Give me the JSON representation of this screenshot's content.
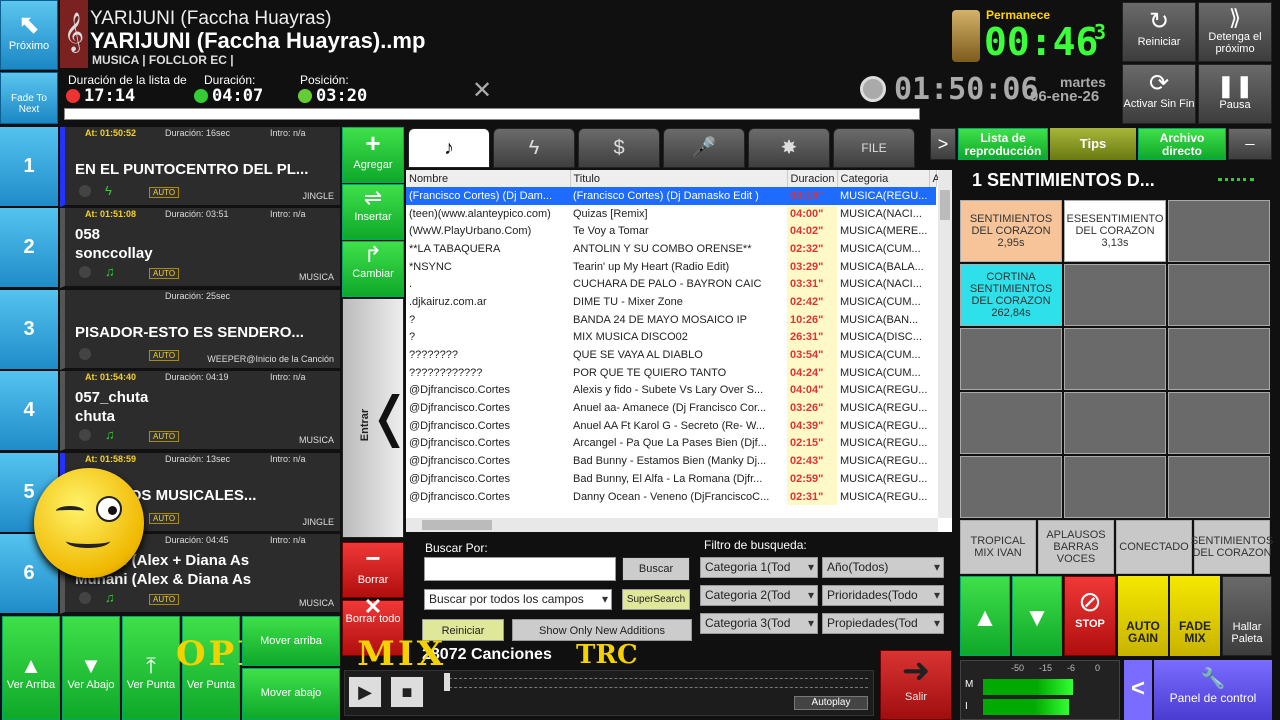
{
  "header": {
    "next_label": "Próximo",
    "fade_label": "Fade To Next",
    "title_small": "YARIJUNI (Faccha Huayras)",
    "title_big": "YARIJUNI (Faccha Huayras)..mp",
    "subtitle": "MUSICA | FOLCLOR EC |",
    "list_dur_label": "Duración de la lista de",
    "dur_label": "Duración:",
    "pos_label": "Posición:",
    "list_dur": "17:14",
    "dur": "04:07",
    "pos": "03:20",
    "clock": "01:50:06",
    "day": "martes",
    "date": "06-ene-26",
    "permanece_label": "Permanece",
    "permanece": "00:46",
    "permanece_tenths": "3"
  },
  "topbtns": {
    "reiniciar": "Reiniciar",
    "detenga": "Detenga el próximo",
    "activar": "Activar Sin Fin",
    "pausa": "Pausa"
  },
  "slots": [
    {
      "num": "1",
      "at": "At: 01:50:52",
      "dur": "Duración: 16sec",
      "intro": "Intro: n/a",
      "line1": "EN EL PUNTOCENTRO DEL PL...",
      "line2": "",
      "cat": "JINGLE",
      "auto": "AUTO"
    },
    {
      "num": "2",
      "at": "At: 01:51:08",
      "dur": "Duración: 03:51",
      "intro": "Intro: n/a",
      "line1": "058",
      "line2": "sonccollay",
      "cat": "MUSICA",
      "auto": "AUTO"
    },
    {
      "num": "3",
      "at": "",
      "dur": "Duración: 25sec",
      "intro": "",
      "line1": "PISADOR-ESTO ES SENDERO...",
      "line2": "",
      "cat": "WEEPER@Inicio de la Canción",
      "auto": "AUTO"
    },
    {
      "num": "4",
      "at": "At: 01:54:40",
      "dur": "Duración: 04:19",
      "intro": "Intro: n/a",
      "line1": "057_chuta",
      "line2": "chuta",
      "cat": "MUSICA",
      "auto": "AUTO"
    },
    {
      "num": "5",
      "at": "At: 01:58:59",
      "dur": "Duración: 13sec",
      "intro": "Intro: n/a",
      "line1": "NAEXITOS MUSICALES...",
      "line2": "",
      "cat": "JINGLE",
      "auto": "AUTO"
    },
    {
      "num": "6",
      "at": "At: 01:59:12",
      "dur": "Duración: 04:45",
      "intro": "Intro: n/a",
      "line1": "Munani (Alex + Diana As",
      "line2": "Munani (Alex & Diana As",
      "cat": "MUSICA",
      "auto": "AUTO"
    }
  ],
  "midbtns": {
    "agregar": "Agregar",
    "insertar": "Insertar",
    "cambiar": "Cambiar",
    "entrar": "Entrar",
    "borrar": "Borrar",
    "borrar_todo": "Borrar todo"
  },
  "tabs": [
    "♪",
    "ϟ",
    "$",
    "🎤",
    "✸",
    "FILE"
  ],
  "cols": [
    "Nombre",
    "Titulo",
    "Duracion",
    "Categoria",
    "A"
  ],
  "rows": [
    [
      "(Francisco Cortes) (Dj Dam...",
      "(Francisco Cortes) (Dj Damasko Edit )",
      "03:19\"",
      "MUSICA(REGU..."
    ],
    [
      "(teen)(www.alanteypico.com)",
      "Quizas [Remix]",
      "04:00\"",
      "MUSICA(NACI..."
    ],
    [
      "(WwW.PlayUrbano.Com)",
      "Te Voy a Tomar",
      "04:02\"",
      "MUSICA(MERE..."
    ],
    [
      "**LA TABAQUERA",
      "ANTOLIN Y SU COMBO ORENSE**",
      "02:32\"",
      "MUSICA(CUM..."
    ],
    [
      "*NSYNC",
      "Tearin' up My Heart (Radio Edit)",
      "03:29\"",
      "MUSICA(BALA..."
    ],
    [
      ".",
      "CUCHARA DE PALO - BAYRON CAIC",
      "03:31\"",
      "MUSICA(NACI..."
    ],
    [
      ".djkairuz.com.ar",
      "DIME TU - Mixer Zone",
      "02:42\"",
      "MUSICA(CUM..."
    ],
    [
      "?",
      "BANDA 24 DE MAYO MOSAICO IP",
      "10:26\"",
      "MUSICA(BAN..."
    ],
    [
      "?",
      "MIX MUSICA DISCO02",
      "26:31\"",
      "MUSICA(DISC..."
    ],
    [
      "????????",
      "QUE SE VAYA AL DIABLO",
      "03:54\"",
      "MUSICA(CUM..."
    ],
    [
      "????????????",
      "POR QUE TE QUIERO TANTO",
      "04:24\"",
      "MUSICA(CUM..."
    ],
    [
      "@Djfrancisco.Cortes",
      "Alexis y fido - Subete Vs Lary Over S...",
      "04:04\"",
      "MUSICA(REGU..."
    ],
    [
      "@Djfrancisco.Cortes",
      "Anuel aa- Amanece (Dj Francisco Cor...",
      "03:26\"",
      "MUSICA(REGU..."
    ],
    [
      "@Djfrancisco.Cortes",
      "Anuel AA Ft Karol G - Secreto (Re- W...",
      "04:39\"",
      "MUSICA(REGU..."
    ],
    [
      "@Djfrancisco.Cortes",
      "Arcangel - Pa Que La Pases Bien (Djf...",
      "02:15\"",
      "MUSICA(REGU..."
    ],
    [
      "@Djfrancisco.Cortes",
      "Bad Bunny - Estamos Bien (Manky Dj...",
      "02:43\"",
      "MUSICA(REGU..."
    ],
    [
      "@Djfrancisco.Cortes",
      "Bad Bunny, El Alfa - La Romana (Djfr...",
      "02:59\"",
      "MUSICA(REGU..."
    ],
    [
      "@Djfrancisco.Cortes",
      "Danny Ocean - Veneno (DjFranciscoC...",
      "02:31\"",
      "MUSICA(REGU..."
    ]
  ],
  "search": {
    "label": "Buscar Por:",
    "buscar": "Buscar",
    "mode": "Buscar por todos los campos",
    "super": "SuperSearch",
    "reiniciar": "Reiniciar",
    "show_new": "Show Only New Additions",
    "count": "28072 Canciones",
    "filtro": "Filtro de busqueda:",
    "c1": "Categoria 1(Tod",
    "c2": "Categoria 2(Tod",
    "c3": "Categoria 3(Tod",
    "anio": "Año(Todos)",
    "prio": "Prioridades(Todo",
    "prop": "Propiedades(Tod"
  },
  "right": {
    "lista": "Lista de reproducción",
    "tips": "Tips",
    "archivo": "Archivo directo",
    "minus": "_",
    "cart_title": "1  SENTIMIENTOS D...",
    "carts": [
      {
        "t": "SENTIMIENTOS DEL CORAZON",
        "s": "2,95s",
        "bg": "#f7c49a"
      },
      {
        "t": "ESESENTIMIENTO DEL CORAZON",
        "s": "3,13s",
        "bg": "#ffffff"
      },
      {
        "t": "CORTINA SENTIMIENTOS DEL CORAZON",
        "s": "262,84s",
        "bg": "#2de0ea"
      }
    ],
    "bottom_tabs": [
      "TROPICAL MIX IVAN",
      "APLAUSOS BARRAS VOCES",
      "CONECTADO",
      "SENTIMIENTOS DEL CORAZON"
    ],
    "stop": "STOP",
    "autogain": "AUTO GAIN",
    "fademix": "FADE MIX",
    "hallar": "Hallar Paleta",
    "panel": "Panel de control",
    "salir": "Salir",
    "lt": "<"
  },
  "bottom": {
    "arriba": "Ver Arriba",
    "abajo": "Ver Abajo",
    "punta": "Ver Punta",
    "verpunta": "Ver Punta",
    "mover_arriba": "Mover arriba",
    "mover_abajo": "Mover abajo",
    "trc": "TRC",
    "logo": "OPICAL MIX",
    "autoplay": "Autoplay",
    "meter_ticks": [
      "-50",
      "-15",
      "-6",
      "0"
    ],
    "m": "M",
    "l": "I"
  }
}
